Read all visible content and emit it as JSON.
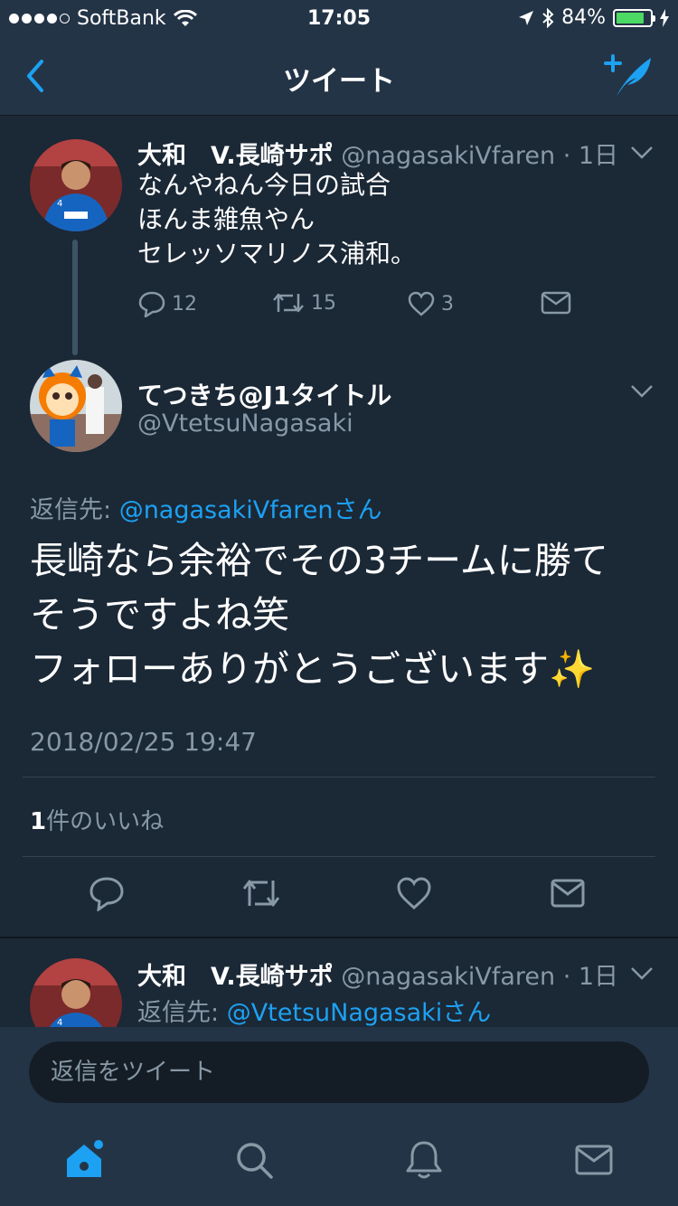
{
  "status_bar": {
    "carrier": "SoftBank",
    "time": "17:05",
    "battery": "84%",
    "battery_level": 0.84
  },
  "nav": {
    "title": "ツイート"
  },
  "tweet1": {
    "name": "大和　V.長崎サポ",
    "handle": "@nagasakiVfaren",
    "time": "· 1日",
    "body": [
      "なんやねん今日の試合",
      "ほんま雑魚やん",
      "セレッソマリノス浦和。"
    ],
    "reply_count": "12",
    "retweet_count": "15",
    "like_count": "3"
  },
  "focus_tweet": {
    "name": "てつきち@J1タイトル",
    "handle": "@VtetsuNagasaki",
    "reply_prefix": "返信先: ",
    "reply_link": "@nagasakiVfarenさん",
    "body": [
      "長崎なら余裕でその3チームに勝て",
      "そうですよね笑",
      "フォローありがとうございます✨"
    ],
    "date": "2018/02/25 19:47",
    "likes_count": "1",
    "likes_label": "件のいいね"
  },
  "tweet3": {
    "name": "大和　V.長崎サポ",
    "handle": "@nagasakiVfaren",
    "time": "· 1日",
    "reply_prefix": "返信先: ",
    "reply_link": "@VtetsuNagasakiさん"
  },
  "reply_bar": {
    "placeholder": "返信をツイート"
  },
  "colors": {
    "accent": "#1da1f2",
    "background": "#1b2836",
    "bar": "#243447",
    "muted": "#8899a6"
  }
}
